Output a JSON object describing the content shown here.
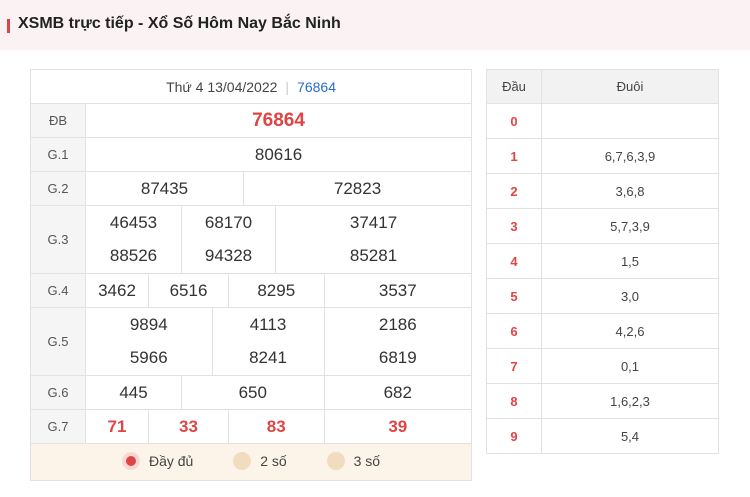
{
  "header": {
    "title": "XSMB trực tiếp - Xổ Số Hôm Nay Bắc Ninh",
    "accent_color": "#e04545"
  },
  "results": {
    "date": "Thứ 4 13/04/2022",
    "code": "76864",
    "rows": [
      {
        "label": "ĐB",
        "values": [
          "76864"
        ]
      },
      {
        "label": "G.1",
        "values": [
          "80616"
        ]
      },
      {
        "label": "G.2",
        "values": [
          "87435",
          "72823"
        ]
      },
      {
        "label": "G.3",
        "values": [
          "46453",
          "68170",
          "37417",
          "88526",
          "94328",
          "85281"
        ]
      },
      {
        "label": "G.4",
        "values": [
          "3462",
          "6516",
          "8295",
          "3537"
        ]
      },
      {
        "label": "G.5",
        "values": [
          "9894",
          "4113",
          "2186",
          "5966",
          "8241",
          "6819"
        ]
      },
      {
        "label": "G.6",
        "values": [
          "445",
          "650",
          "682"
        ]
      },
      {
        "label": "G.7",
        "values": [
          "71",
          "33",
          "83",
          "39"
        ]
      }
    ],
    "options": [
      {
        "label": "Đầy đủ",
        "selected": true
      },
      {
        "label": "2 số",
        "selected": false
      },
      {
        "label": "3 số",
        "selected": false
      }
    ]
  },
  "headtail": {
    "head_header": "Đầu",
    "tail_header": "Đuôi",
    "rows": [
      {
        "head": "0",
        "tail": ""
      },
      {
        "head": "1",
        "tail": "6,7,6,3,9"
      },
      {
        "head": "2",
        "tail": "3,6,8"
      },
      {
        "head": "3",
        "tail": "5,7,3,9"
      },
      {
        "head": "4",
        "tail": "1,5"
      },
      {
        "head": "5",
        "tail": "3,0"
      },
      {
        "head": "6",
        "tail": "4,2,6"
      },
      {
        "head": "7",
        "tail": "0,1"
      },
      {
        "head": "8",
        "tail": "1,6,2,3"
      },
      {
        "head": "9",
        "tail": "5,4"
      }
    ]
  }
}
